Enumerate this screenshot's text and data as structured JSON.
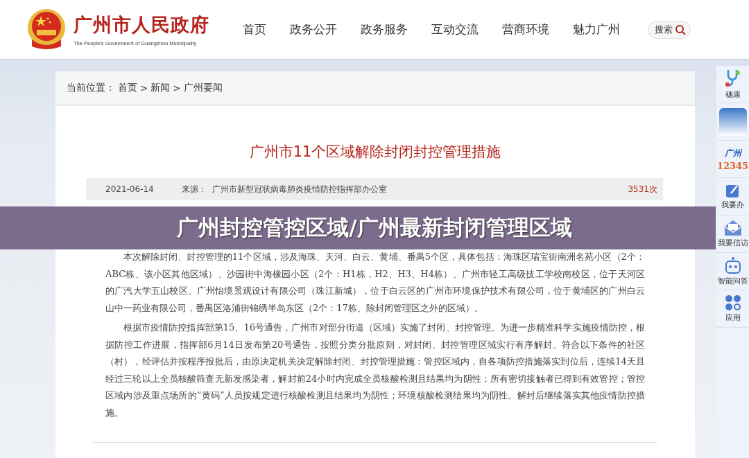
{
  "header": {
    "site_name": "广州市人民政府",
    "site_subtitle": "The People's Government of Guangzhou Municipality",
    "nav": [
      {
        "label": "首页"
      },
      {
        "label": "政务公开"
      },
      {
        "label": "政务服务"
      },
      {
        "label": "互动交流"
      },
      {
        "label": "营商环境"
      },
      {
        "label": "魅力广州"
      }
    ],
    "search_button": "搜索"
  },
  "breadcrumb": {
    "label": "当前位置：",
    "items": [
      "首页",
      "新闻",
      "广州要闻"
    ],
    "separator": ">"
  },
  "article": {
    "title": "广州市11个区域解除封闭封控管理措施",
    "date": "2021-06-14",
    "source_label": "来源：",
    "source": "广州市新型冠状病毒肺炎疫情防控指挥部办公室",
    "views": "3531次",
    "paragraphs": [
      "本次解除封闭、封控管理的11个区域，涉及海珠、天河、白云、黄埔、番禺5个区，具体包括：海珠区瑞宝街南洲名苑小区（2个：ABC栋、该小区其他区域）、沙园街中海橡园小区（2个：H1栋，H2、H3、H4栋）、广州市轻工高级技工学校南校区，位于天河区的广汽大学五山校区、广州怡境景观设计有限公司（珠江新城），位于白云区的广州市环境保护技术有限公司，位于黄埔区的广州白云山中一药业有限公司，番禺区洛浦街锦绣半岛东区（2个：17栋、除封闭管理区之外的区域）。",
      "根据市疫情防控指挥部第15、16号通告，广州市对部分街道（区域）实施了封闭、封控管理。为进一步精准科学实施疫情防控，根据防控工作进展，指挥部6月14日发布第20号通告，按照分类分批原则，对封闭、封控管理区域实行有序解封。符合以下条件的社区（村），经评估并按程序报批后，由原决定机关决定解除封闭、封控管理措施：管控区域内，自各项防控措施落实到位后，连续14天且经过三轮以上全员核酸筛查无新发感染者，解封前24小时内完成全员核酸检测且结果均为阴性；所有密切接触者已得到有效管控；管控区域内涉及重点场所的“黄码”人员按规定进行核酸检测且结果均为阴性；环境核酸检测结果均为阴性。解封后继续落实其他疫情防控措施。"
    ]
  },
  "sidebar": [
    {
      "kind": "health",
      "label": "穗康"
    },
    {
      "kind": "app"
    },
    {
      "kind": "hotline",
      "line1": "广州",
      "line2": "12345"
    },
    {
      "kind": "edit",
      "label": "我要办"
    },
    {
      "kind": "mail",
      "label": "我要信访"
    },
    {
      "kind": "robot",
      "label": "智能问答"
    },
    {
      "kind": "apps",
      "label": "应用"
    }
  ],
  "banner": {
    "title": "广州封控管控区域/广州最新封闭管理区域"
  }
}
